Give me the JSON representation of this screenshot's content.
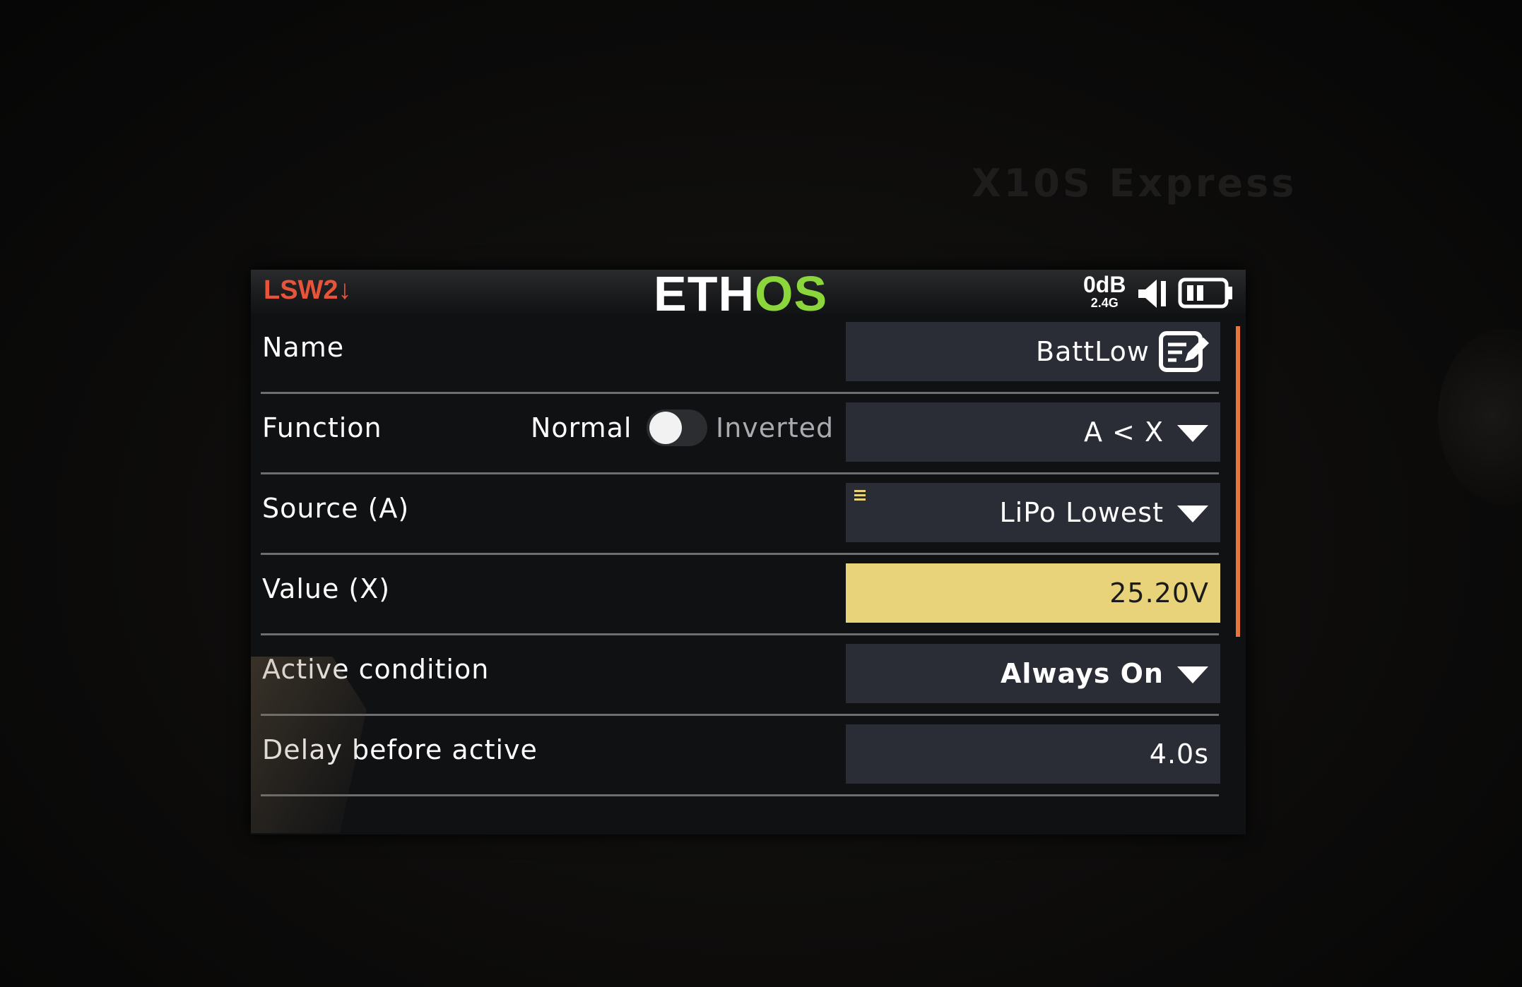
{
  "bezel": {
    "model_label": "X10S Express"
  },
  "status": {
    "switch_label": "LSW2↓",
    "logo_left": "ETH",
    "logo_right": "OS",
    "rssi": "0dB",
    "band": "2.4G"
  },
  "form": {
    "rows": [
      {
        "label": "Name",
        "value": "BattLow"
      },
      {
        "label": "Function",
        "value": "A < X",
        "toggle": {
          "off_label": "Normal",
          "on_label": "Inverted",
          "state": "Normal"
        }
      },
      {
        "label": "Source (A)",
        "value": "LiPo Lowest"
      },
      {
        "label": "Value (X)",
        "value": "25.20V"
      },
      {
        "label": "Active condition",
        "value": "Always On"
      },
      {
        "label": "Delay before active",
        "value": "4.0s"
      }
    ]
  },
  "colors": {
    "accent_orange": "#e8763a",
    "switch_red": "#e8543a",
    "logo_green": "#8bd63a",
    "highlight_yellow": "#e8d27a",
    "field_bg": "#2a2d36"
  },
  "icons": {
    "name_edit": "edit-icon",
    "dropdown": "chevron-down-icon",
    "source_list": "list-icon",
    "speaker": "speaker-icon",
    "battery": "battery-icon"
  }
}
